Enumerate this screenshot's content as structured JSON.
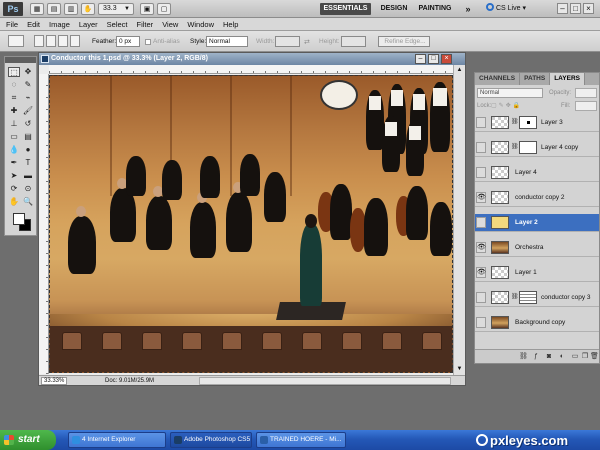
{
  "app_bar": {
    "logo": "Ps",
    "zoom_level": "33.3",
    "workspaces": [
      "ESSENTIALS",
      "DESIGN",
      "PAINTING"
    ],
    "more_label": "»",
    "cs_live_label": "CS Live"
  },
  "menu": {
    "items": [
      "File",
      "Edit",
      "Image",
      "Layer",
      "Select",
      "Filter",
      "View",
      "Window",
      "Help"
    ]
  },
  "options_bar": {
    "feather_label": "Feather:",
    "feather_value": "0 px",
    "antialias_label": "Anti-alias",
    "style_label": "Style:",
    "style_value": "Normal",
    "width_label": "Width:",
    "height_label": "Height:",
    "refine_edge_label": "Refine Edge..."
  },
  "document": {
    "title": "Conductor this 1.psd @ 33.3% (Layer 2, RGB/8)",
    "zoom_value": "33.33%",
    "doc_size": "Doc: 9.01M/25.9M"
  },
  "layers_panel": {
    "tabs": [
      "CHANNELS",
      "PATHS",
      "LAYERS"
    ],
    "active_tab": "LAYERS",
    "blend_mode": "Normal",
    "opacity_label": "Opacity:",
    "lock_label": "Lock:",
    "fill_label": "Fill:",
    "layers": [
      {
        "name": "Layer 3",
        "visible": false,
        "thumb": "checker",
        "mask": "dot",
        "selected": false
      },
      {
        "name": "Layer 4 copy",
        "visible": false,
        "thumb": "checker",
        "mask": "plain",
        "selected": false
      },
      {
        "name": "Layer 4",
        "visible": false,
        "thumb": "checker",
        "mask": "",
        "selected": false
      },
      {
        "name": "conductor copy 2",
        "visible": true,
        "thumb": "checker",
        "mask": "",
        "selected": false
      },
      {
        "name": "Layer 2",
        "visible": false,
        "thumb": "yellow",
        "mask": "",
        "selected": true
      },
      {
        "name": "Orchestra",
        "visible": true,
        "thumb": "photo",
        "mask": "",
        "selected": false
      },
      {
        "name": "Layer 1",
        "visible": true,
        "thumb": "checker",
        "mask": "",
        "selected": false
      },
      {
        "name": "conductor copy 3",
        "visible": false,
        "thumb": "checker",
        "mask": "lines",
        "selected": false
      },
      {
        "name": "Background copy",
        "visible": false,
        "thumb": "photo",
        "mask": "",
        "selected": false
      }
    ]
  },
  "taskbar": {
    "start_label": "start",
    "tasks": [
      {
        "label": "4 Internet Explorer",
        "active": false,
        "icon_color": "#2f8fe0"
      },
      {
        "label": "Adobe Photoshop CS5",
        "active": true,
        "icon_color": "#1a3d66"
      },
      {
        "label": "TRAINED HOERE - Mi...",
        "active": false,
        "icon_color": "#2a5fa8"
      }
    ],
    "brand": "pxleyes.com"
  }
}
